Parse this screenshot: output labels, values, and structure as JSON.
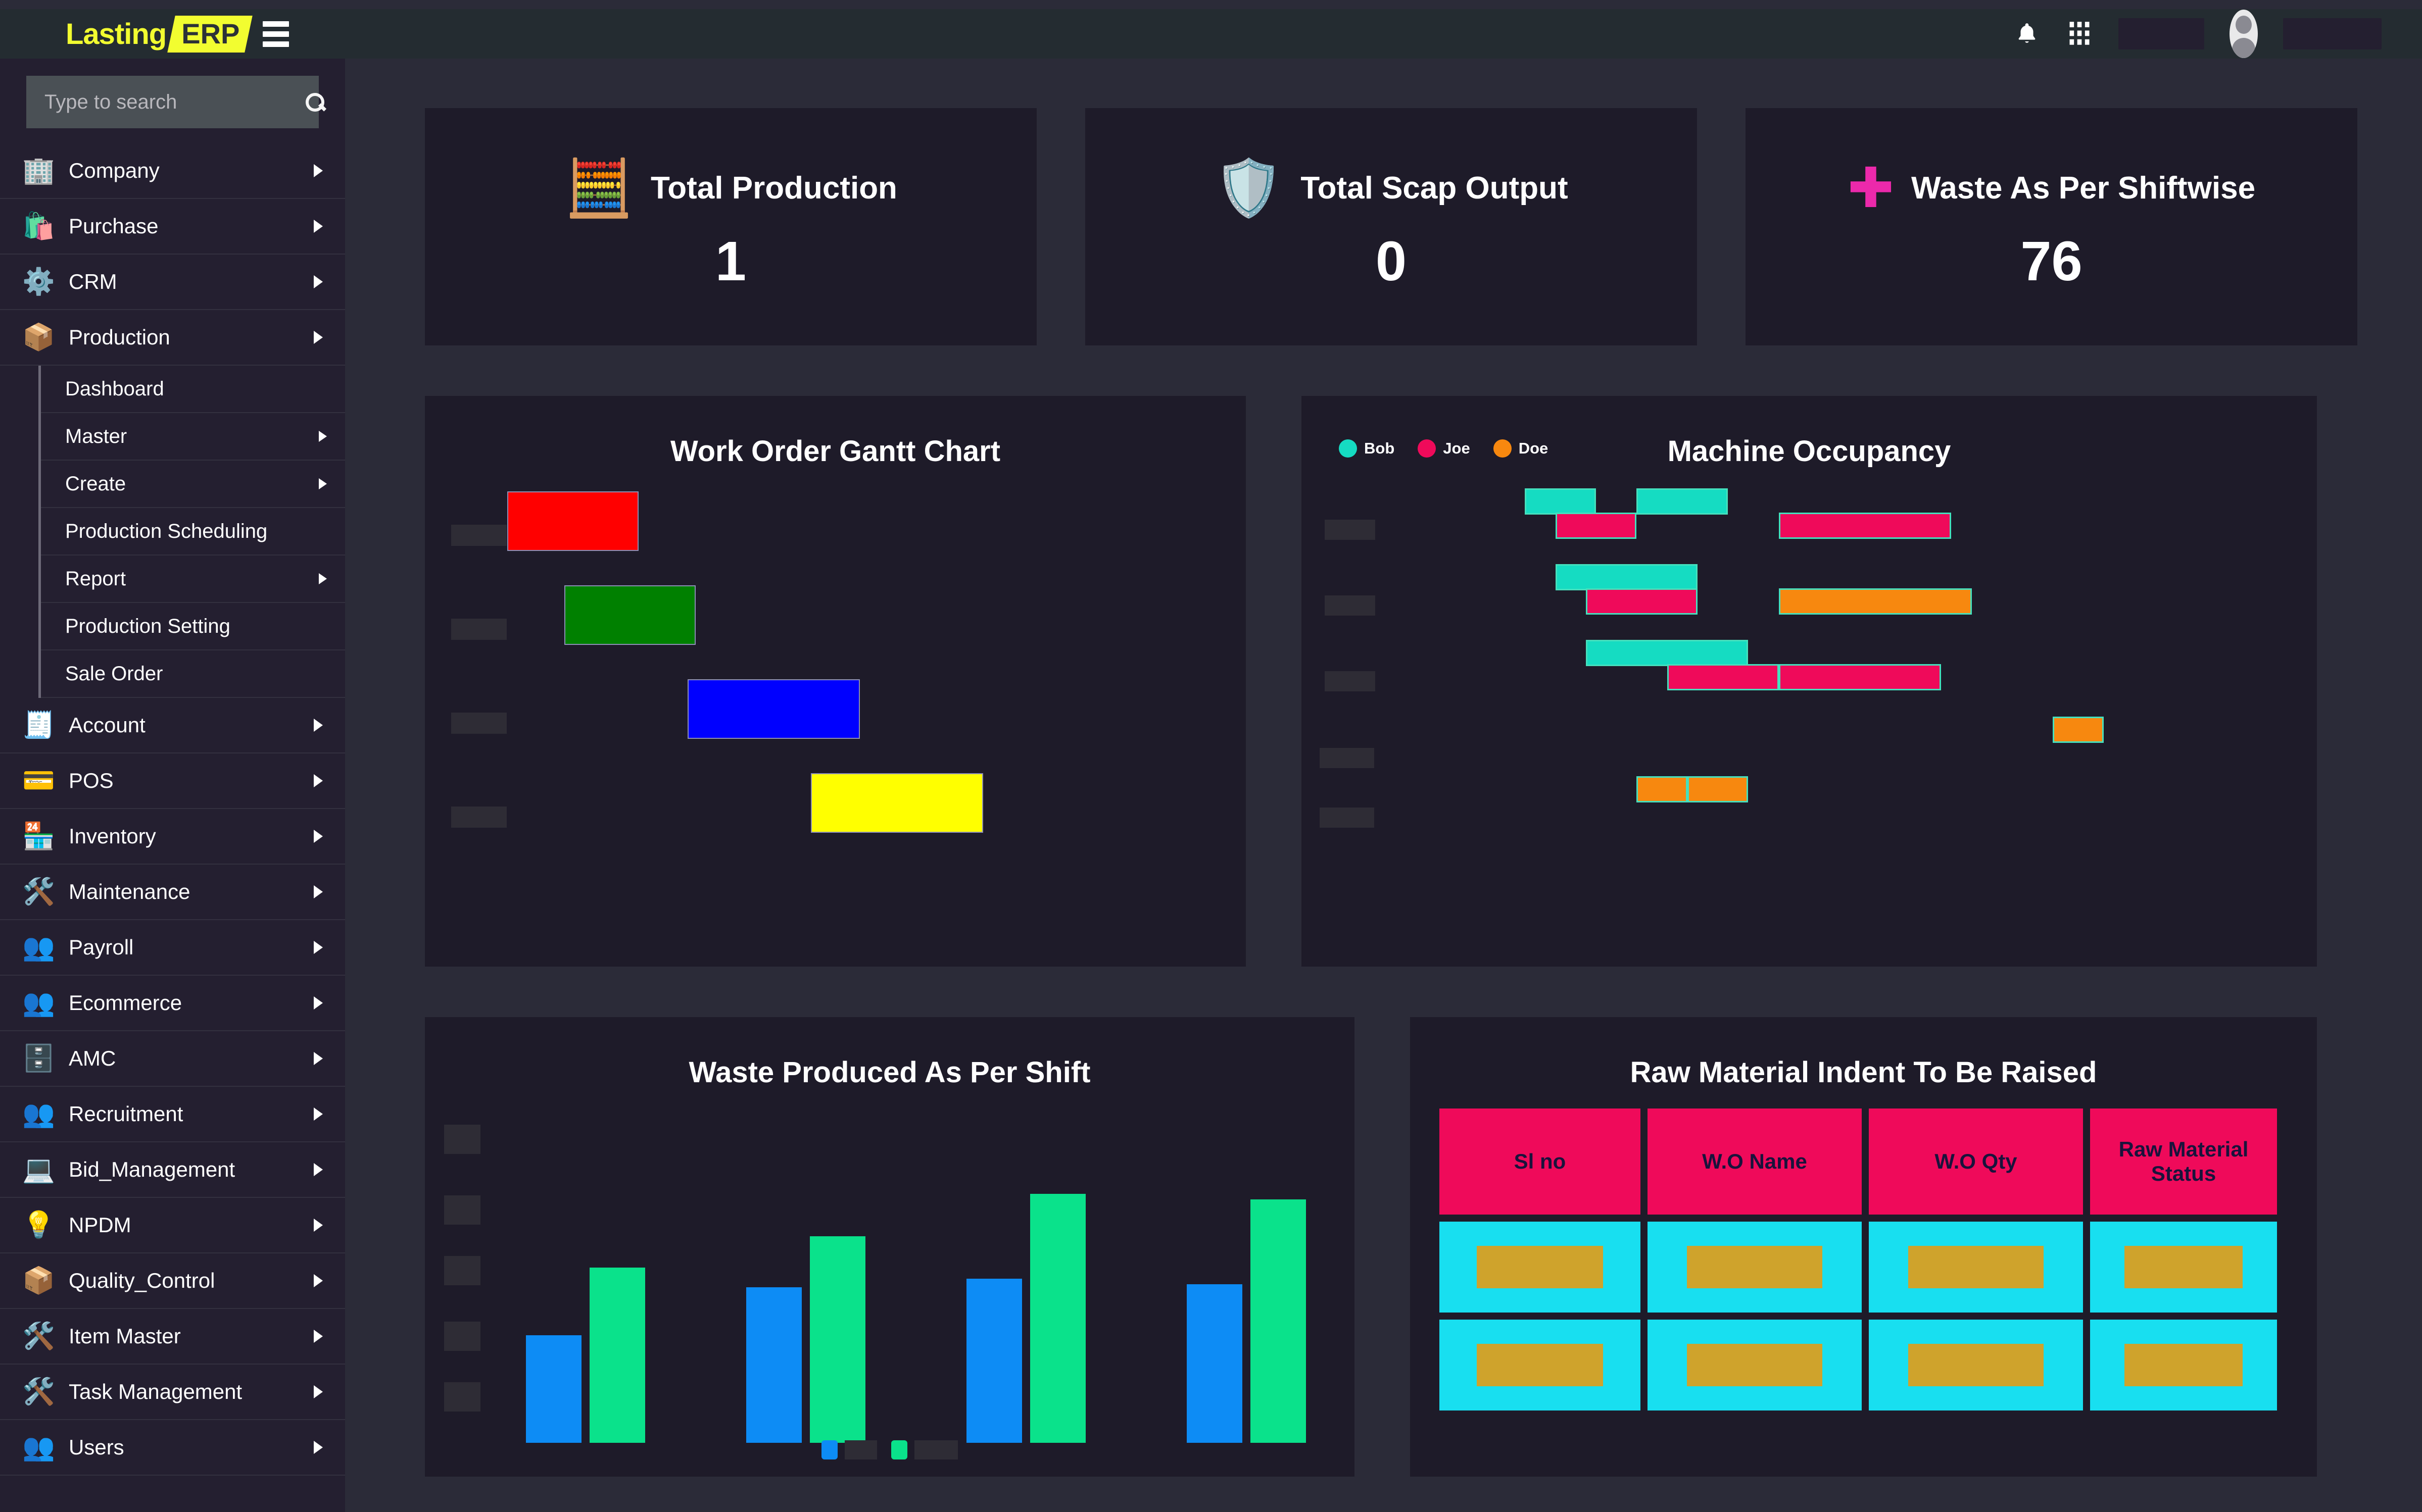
{
  "brand": {
    "name_primary": "Lasting",
    "name_badge": "ERP",
    "color_yellow": "#f2fd30",
    "color_bar": "#242c31"
  },
  "header": {
    "menu_toggle": "hamburger-menu",
    "icons": {
      "notifications": "bell-icon",
      "apps": "grid-icon",
      "profile": "avatar-icon"
    }
  },
  "search": {
    "placeholder": "Type to search",
    "value": "",
    "icon": "search-icon"
  },
  "sidebar": {
    "items": [
      {
        "label": "Company",
        "icon": "🏢",
        "has_submenu": true
      },
      {
        "label": "Purchase",
        "icon": "🛍️",
        "has_submenu": true
      },
      {
        "label": "CRM",
        "icon": "⚙️",
        "has_submenu": true
      },
      {
        "label": "Production",
        "icon": "📦",
        "has_submenu": true,
        "expanded": true
      },
      {
        "label": "Account",
        "icon": "🧾",
        "has_submenu": true
      },
      {
        "label": "POS",
        "icon": "💳",
        "has_submenu": true
      },
      {
        "label": "Inventory",
        "icon": "🏪",
        "has_submenu": true
      },
      {
        "label": "Maintenance",
        "icon": "🛠️",
        "has_submenu": true
      },
      {
        "label": "Payroll",
        "icon": "👥",
        "has_submenu": true
      },
      {
        "label": "Ecommerce",
        "icon": "👥",
        "has_submenu": true
      },
      {
        "label": "AMC",
        "icon": "🗄️",
        "has_submenu": true
      },
      {
        "label": "Recruitment",
        "icon": "👥",
        "has_submenu": true
      },
      {
        "label": "Bid_Management",
        "icon": "💻",
        "has_submenu": true
      },
      {
        "label": "NPDM",
        "icon": "💡",
        "has_submenu": true
      },
      {
        "label": "Quality_Control",
        "icon": "📦",
        "has_submenu": true
      },
      {
        "label": "Item Master",
        "icon": "🛠️",
        "has_submenu": true
      },
      {
        "label": "Task Management",
        "icon": "🛠️",
        "has_submenu": true
      },
      {
        "label": "Users",
        "icon": "👥",
        "has_submenu": true
      }
    ],
    "production_submenu": [
      {
        "label": "Dashboard",
        "has_submenu": false
      },
      {
        "label": "Master",
        "has_submenu": true
      },
      {
        "label": "Create",
        "has_submenu": true
      },
      {
        "label": "Production Scheduling",
        "has_submenu": false
      },
      {
        "label": "Report",
        "has_submenu": true
      },
      {
        "label": "Production Setting",
        "has_submenu": false
      },
      {
        "label": "Sale Order",
        "has_submenu": false
      }
    ]
  },
  "kpis": [
    {
      "title": "Total Production",
      "value": "1",
      "icon": "🧮",
      "color": "#fd1414"
    },
    {
      "title": "Total Scap Output",
      "value": "0",
      "icon": "🛡️",
      "color": "#5b2ef0"
    },
    {
      "title": "Waste As Per Shiftwise",
      "value": "76",
      "icon": "✚",
      "color": "#ec29ab"
    }
  ],
  "chart_data": [
    {
      "type": "bar",
      "orientation": "horizontal",
      "title": "Work Order Gantt Chart",
      "subtype": "gantt",
      "categories": [
        "",
        "",
        "",
        ""
      ],
      "note": "Category labels are redacted in the screenshot",
      "bars": [
        {
          "row": 0,
          "start": 10,
          "end": 26,
          "color": "#ff0000",
          "label": ""
        },
        {
          "row": 1,
          "start": 17,
          "end": 33,
          "color": "#008000",
          "label": ""
        },
        {
          "row": 2,
          "start": 32,
          "end": 53,
          "color": "#0000ff",
          "label": ""
        },
        {
          "row": 3,
          "start": 47,
          "end": 68,
          "color": "#ffff00",
          "label": ""
        }
      ],
      "xlabel": "",
      "ylabel": "",
      "grid": false,
      "legend": "none"
    },
    {
      "type": "bar",
      "orientation": "horizontal",
      "subtype": "gantt",
      "title": "Machine Occupancy",
      "legend": {
        "position": "top-left",
        "entries": [
          {
            "name": "Bob",
            "color": "#15dcc2"
          },
          {
            "name": "Joe",
            "color": "#ef0a5a"
          },
          {
            "name": "Doe",
            "color": "#f7880f"
          }
        ]
      },
      "categories": [
        "",
        "",
        "",
        "",
        ""
      ],
      "note": "Machine row labels are redacted in the screenshot",
      "bars": [
        {
          "row": 0,
          "start": 22,
          "end": 29,
          "color": "#15dcc2",
          "series": "Bob"
        },
        {
          "row": 0,
          "start": 33,
          "end": 42,
          "color": "#15dcc2",
          "series": "Bob"
        },
        {
          "row": 0,
          "start": 25,
          "end": 33,
          "color": "#ef0a5a",
          "series": "Joe",
          "offset": true
        },
        {
          "row": 0,
          "start": 47,
          "end": 64,
          "color": "#ef0a5a",
          "series": "Joe",
          "offset": true
        },
        {
          "row": 1,
          "start": 25,
          "end": 39,
          "color": "#15dcc2",
          "series": "Bob"
        },
        {
          "row": 1,
          "start": 28,
          "end": 39,
          "color": "#ef0a5a",
          "series": "Joe",
          "offset": true
        },
        {
          "row": 1,
          "start": 47,
          "end": 66,
          "color": "#f7880f",
          "series": "Doe",
          "offset": true
        },
        {
          "row": 2,
          "start": 28,
          "end": 44,
          "color": "#15dcc2",
          "series": "Bob"
        },
        {
          "row": 2,
          "start": 36,
          "end": 47,
          "color": "#ef0a5a",
          "series": "Joe",
          "offset": true
        },
        {
          "row": 2,
          "start": 47,
          "end": 63,
          "color": "#ef0a5a",
          "series": "Joe",
          "offset": true
        },
        {
          "row": 3,
          "start": 74,
          "end": 79,
          "color": "#f7880f",
          "series": "Doe"
        },
        {
          "row": 4,
          "start": 33,
          "end": 38,
          "color": "#f7880f",
          "series": "Doe"
        },
        {
          "row": 4,
          "start": 38,
          "end": 44,
          "color": "#f7880f",
          "series": "Doe"
        }
      ],
      "xlabel": "",
      "ylabel": "",
      "grid": false
    },
    {
      "type": "bar",
      "title": "Waste Produced As Per Shift",
      "categories": [
        "",
        "",
        "",
        ""
      ],
      "note": "Category and axis tick labels are redacted in the screenshot",
      "series": [
        {
          "name": "",
          "color": "#0d8cf5",
          "values": [
            38,
            55,
            58,
            56
          ]
        },
        {
          "name": "",
          "color": "#0ae28b",
          "values": [
            62,
            73,
            88,
            86
          ]
        }
      ],
      "ylim": [
        0,
        100
      ],
      "xlabel": "",
      "ylabel": "",
      "grid": false,
      "legend": "bottom-center"
    },
    {
      "type": "table",
      "title": "Raw Material Indent To Be Raised",
      "columns": [
        "Sl no",
        "W.O Name",
        "W.O Qty",
        "Raw Material Status"
      ],
      "rows": [
        [
          "",
          "",
          "",
          ""
        ],
        [
          "",
          "",
          "",
          ""
        ]
      ],
      "note": "Cell values are redacted in the screenshot",
      "header_bg": "#ef0a5a",
      "header_fg": "#19133c",
      "cell_bg": "#18dff0",
      "cell_redact": "#cfa32c"
    }
  ],
  "panels": {
    "gantt_title": "Work Order Gantt Chart",
    "occupancy_title": "Machine Occupancy",
    "waste_title": "Waste Produced As Per Shift",
    "table_title": "Raw Material Indent To Be Raised"
  }
}
